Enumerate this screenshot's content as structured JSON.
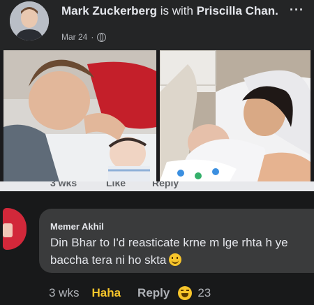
{
  "post": {
    "author": "Mark Zuckerberg",
    "with_text": "is with",
    "tagged": "Priscilla Chan.",
    "date": "Mar 24",
    "separator": "·",
    "more_label": "···"
  },
  "cutoff_actions": {
    "time": "3 wks",
    "like": "Like",
    "reply": "Reply"
  },
  "comment": {
    "author": "Memer Akhil",
    "text": "Din Bhar to I'd reasticate krne m lge rhta h ye baccha tera ni ho skta",
    "emoji": "smiling-face-icon",
    "time": "3 wks",
    "reaction_label": "Haha",
    "reply_label": "Reply",
    "reaction_emoji": "laughing-face-icon",
    "reaction_count": "23"
  },
  "colors": {
    "background": "#1b1b1d",
    "bubble": "#3a3b3c",
    "haha": "#f7c52b",
    "text": "#e4e6eb",
    "muted": "#b0b3b8"
  }
}
